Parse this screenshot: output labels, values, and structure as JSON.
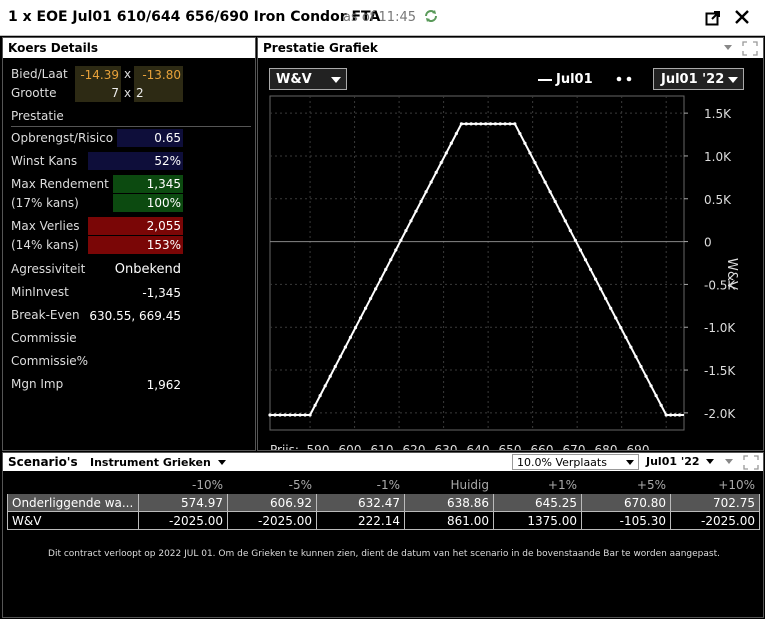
{
  "window": {
    "title": "1 x EOE Jul01 610/644 656/690 Iron Condor FTA",
    "as_of": "as of 11:45"
  },
  "koers": {
    "header": "Koers Details",
    "bied_laat_label": "Bied/Laat",
    "bid": "-14.39",
    "x1": "x",
    "ask": "-13.80",
    "grootte_label": "Grootte",
    "size_bid": "7",
    "x2": "x",
    "size_ask": "2",
    "prestatie_label": "Prestatie",
    "rows": [
      {
        "label": "Opbrengst/Risico",
        "value": "0.65"
      },
      {
        "label": "Winst Kans",
        "value": "52%"
      },
      {
        "label": "Max Rendement",
        "value": "1,345"
      },
      {
        "label": "(17% kans)",
        "value": "100%"
      },
      {
        "label": "Max Verlies",
        "value": "2,055"
      },
      {
        "label": "(14% kans)",
        "value": "153%"
      },
      {
        "label": "Agressiviteit",
        "value": "Onbekend"
      },
      {
        "label": "MinInvest",
        "value": "-1,345"
      },
      {
        "label": "Break-Even",
        "value": "630.55, 669.45"
      },
      {
        "label": "Commissie",
        "value": ""
      },
      {
        "label": "Commissie%",
        "value": ""
      },
      {
        "label": "Mgn Imp",
        "value": "1,962"
      }
    ]
  },
  "prestatie": {
    "header": "Prestatie Grafiek",
    "mode_select": "W&V",
    "legend_line": "Jul01",
    "expiry_select": "Jul01 '22",
    "prijs_label": "Prijs:"
  },
  "chart_data": {
    "type": "line",
    "xlabel": "Prijs:",
    "ylabel": "W&V",
    "xlim": [
      601,
      694
    ],
    "ylim": [
      -2200,
      1700
    ],
    "x_ticks": [
      590,
      600,
      610,
      620,
      630,
      640,
      650,
      660,
      670,
      680,
      690
    ],
    "y_ticks": [
      1500,
      1000,
      500,
      0,
      -500,
      -1000,
      -1500,
      -2000
    ],
    "y_tick_labels": [
      "1.5K",
      "1.0K",
      "0.5K",
      "0",
      "-0.5K",
      "-1.0K",
      "-1.5K",
      "-2.0K"
    ],
    "series": [
      {
        "name": "Jul01",
        "x": [
          601,
          610,
          644,
          656,
          690,
          694
        ],
        "y": [
          -2025,
          -2025,
          1375,
          1375,
          -2025,
          -2025
        ]
      }
    ]
  },
  "scenario": {
    "header": "Scenario's",
    "greeks_select": "Instrument Grieken",
    "shift_select": "10.0% Verplaats",
    "expiry_select": "Jul01 '22",
    "columns": [
      "",
      "-10%",
      "-5%",
      "-1%",
      "Huidig",
      "+1%",
      "+5%",
      "+10%"
    ],
    "rows": [
      {
        "label": "Onderliggende wa...",
        "values": [
          "574.97",
          "606.92",
          "632.47",
          "638.86",
          "645.25",
          "670.80",
          "702.75"
        ]
      },
      {
        "label": "W&V",
        "values": [
          "-2025.00",
          "-2025.00",
          "222.14",
          "861.00",
          "1375.00",
          "-105.30",
          "-2025.00"
        ]
      }
    ],
    "note": "Dit contract verloopt op 2022 JUL 01. Om de Grieken te kunnen zien, dient de datum van het scenario in de bovenstaande Bar te worden aangepast."
  },
  "colors": {
    "gold_text": "#e8a23a",
    "blue_bg": "#0e0e3a",
    "green_bg": "#0c4a10",
    "red_bg": "#7a0606",
    "refresh_green": "#5a9a5a"
  }
}
